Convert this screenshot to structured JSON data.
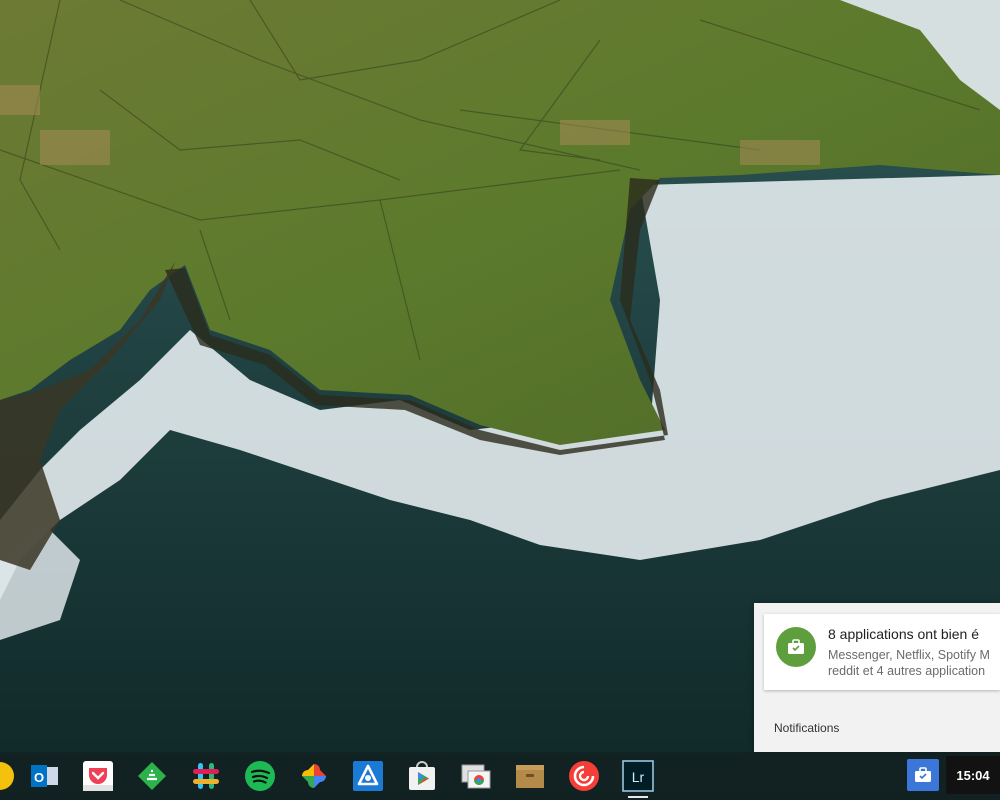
{
  "notification": {
    "app_icon": "briefcase-icon",
    "title": "8 applications ont bien é",
    "body_line1": "Messenger, Netflix, Spotify M",
    "body_line2": "reddit et 4 autres application",
    "footer_label": "Notifications",
    "accent_color": "#5f9e3c"
  },
  "shelf": {
    "apps": [
      {
        "name": "chrome",
        "icon": "chrome-icon"
      },
      {
        "name": "outlook",
        "icon": "outlook-icon",
        "glyph": "O"
      },
      {
        "name": "pocket",
        "icon": "pocket-icon"
      },
      {
        "name": "feedly",
        "icon": "feedly-icon"
      },
      {
        "name": "slack",
        "icon": "slack-icon"
      },
      {
        "name": "spotify",
        "icon": "spotify-icon"
      },
      {
        "name": "google-photos",
        "icon": "pinwheel-icon"
      },
      {
        "name": "app-blue-a",
        "icon": "a-logo-icon"
      },
      {
        "name": "google-play",
        "icon": "play-store-icon"
      },
      {
        "name": "chrome-remote",
        "icon": "remote-desktop-icon"
      },
      {
        "name": "archive",
        "icon": "box-icon"
      },
      {
        "name": "pocket-casts",
        "icon": "pocket-casts-icon"
      },
      {
        "name": "lightroom",
        "icon": "lightroom-icon",
        "glyph": "Lr"
      }
    ],
    "status_notification_icon": "briefcase-icon",
    "clock": "15:04"
  },
  "colors": {
    "status_button": "#3c76d8",
    "clock_bg": "#121212"
  }
}
